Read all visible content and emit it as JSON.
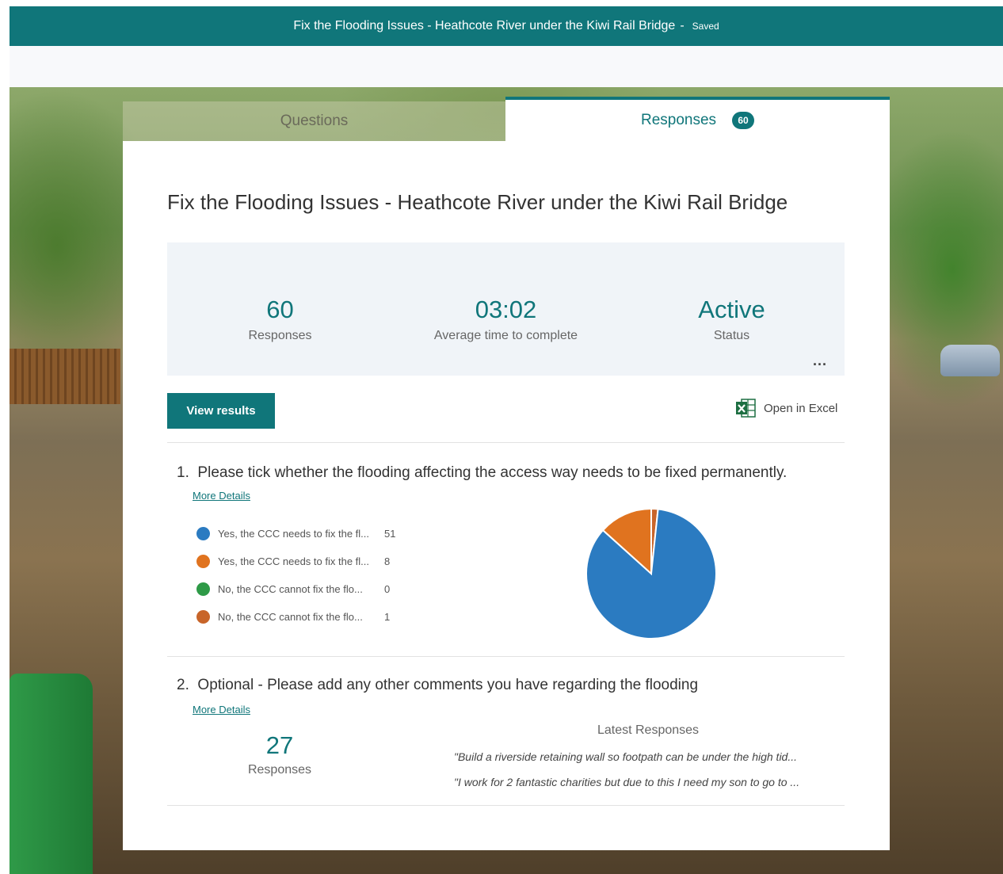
{
  "header": {
    "title": "Fix the Flooding Issues - Heathcote River under the Kiwi Rail Bridge",
    "separator": "-",
    "status": "Saved"
  },
  "tabs": {
    "questions_label": "Questions",
    "responses_label": "Responses",
    "responses_badge": "60"
  },
  "form": {
    "title": "Fix the Flooding Issues - Heathcote River under the Kiwi Rail Bridge"
  },
  "summary": {
    "responses_value": "60",
    "responses_label": "Responses",
    "avg_time_value": "03:02",
    "avg_time_label": "Average time to complete",
    "status_value": "Active",
    "status_label": "Status",
    "more_label": "..."
  },
  "actions": {
    "view_results": "View results",
    "open_excel": "Open in Excel",
    "excel_icon": "excel-icon"
  },
  "questions": [
    {
      "number": "1.",
      "text": "Please tick whether the flooding affecting the access way needs to be fixed permanently.",
      "more_details": "More Details",
      "options": [
        {
          "label": "Yes, the CCC needs to fix the fl...",
          "count": "51",
          "color": "#2b7bc1"
        },
        {
          "label": "Yes, the CCC needs to fix the fl...",
          "count": "8",
          "color": "#e0731f"
        },
        {
          "label": "No, the CCC cannot fix the flo...",
          "count": "0",
          "color": "#2e9a47"
        },
        {
          "label": "No, the CCC cannot fix the flo...",
          "count": "1",
          "color": "#c8652a"
        }
      ]
    },
    {
      "number": "2.",
      "text": "Optional - Please add any other comments you have regarding the flooding",
      "more_details": "More Details",
      "responses_value": "27",
      "responses_label": "Responses",
      "latest_header": "Latest Responses",
      "latest": [
        "\"Build a riverside retaining wall so footpath can be under the high tid...",
        "\"I work for 2 fantastic charities but due to this I need my son to go to ..."
      ]
    }
  ],
  "chart_data": {
    "type": "pie",
    "categories": [
      "Yes, the CCC needs to fix the fl...",
      "Yes, the CCC needs to fix the fl...",
      "No, the CCC cannot fix the flo...",
      "No, the CCC cannot fix the flo..."
    ],
    "values": [
      51,
      8,
      0,
      1
    ],
    "colors": [
      "#2b7bc1",
      "#e0731f",
      "#2e9a47",
      "#c8652a"
    ],
    "legend": "left"
  }
}
